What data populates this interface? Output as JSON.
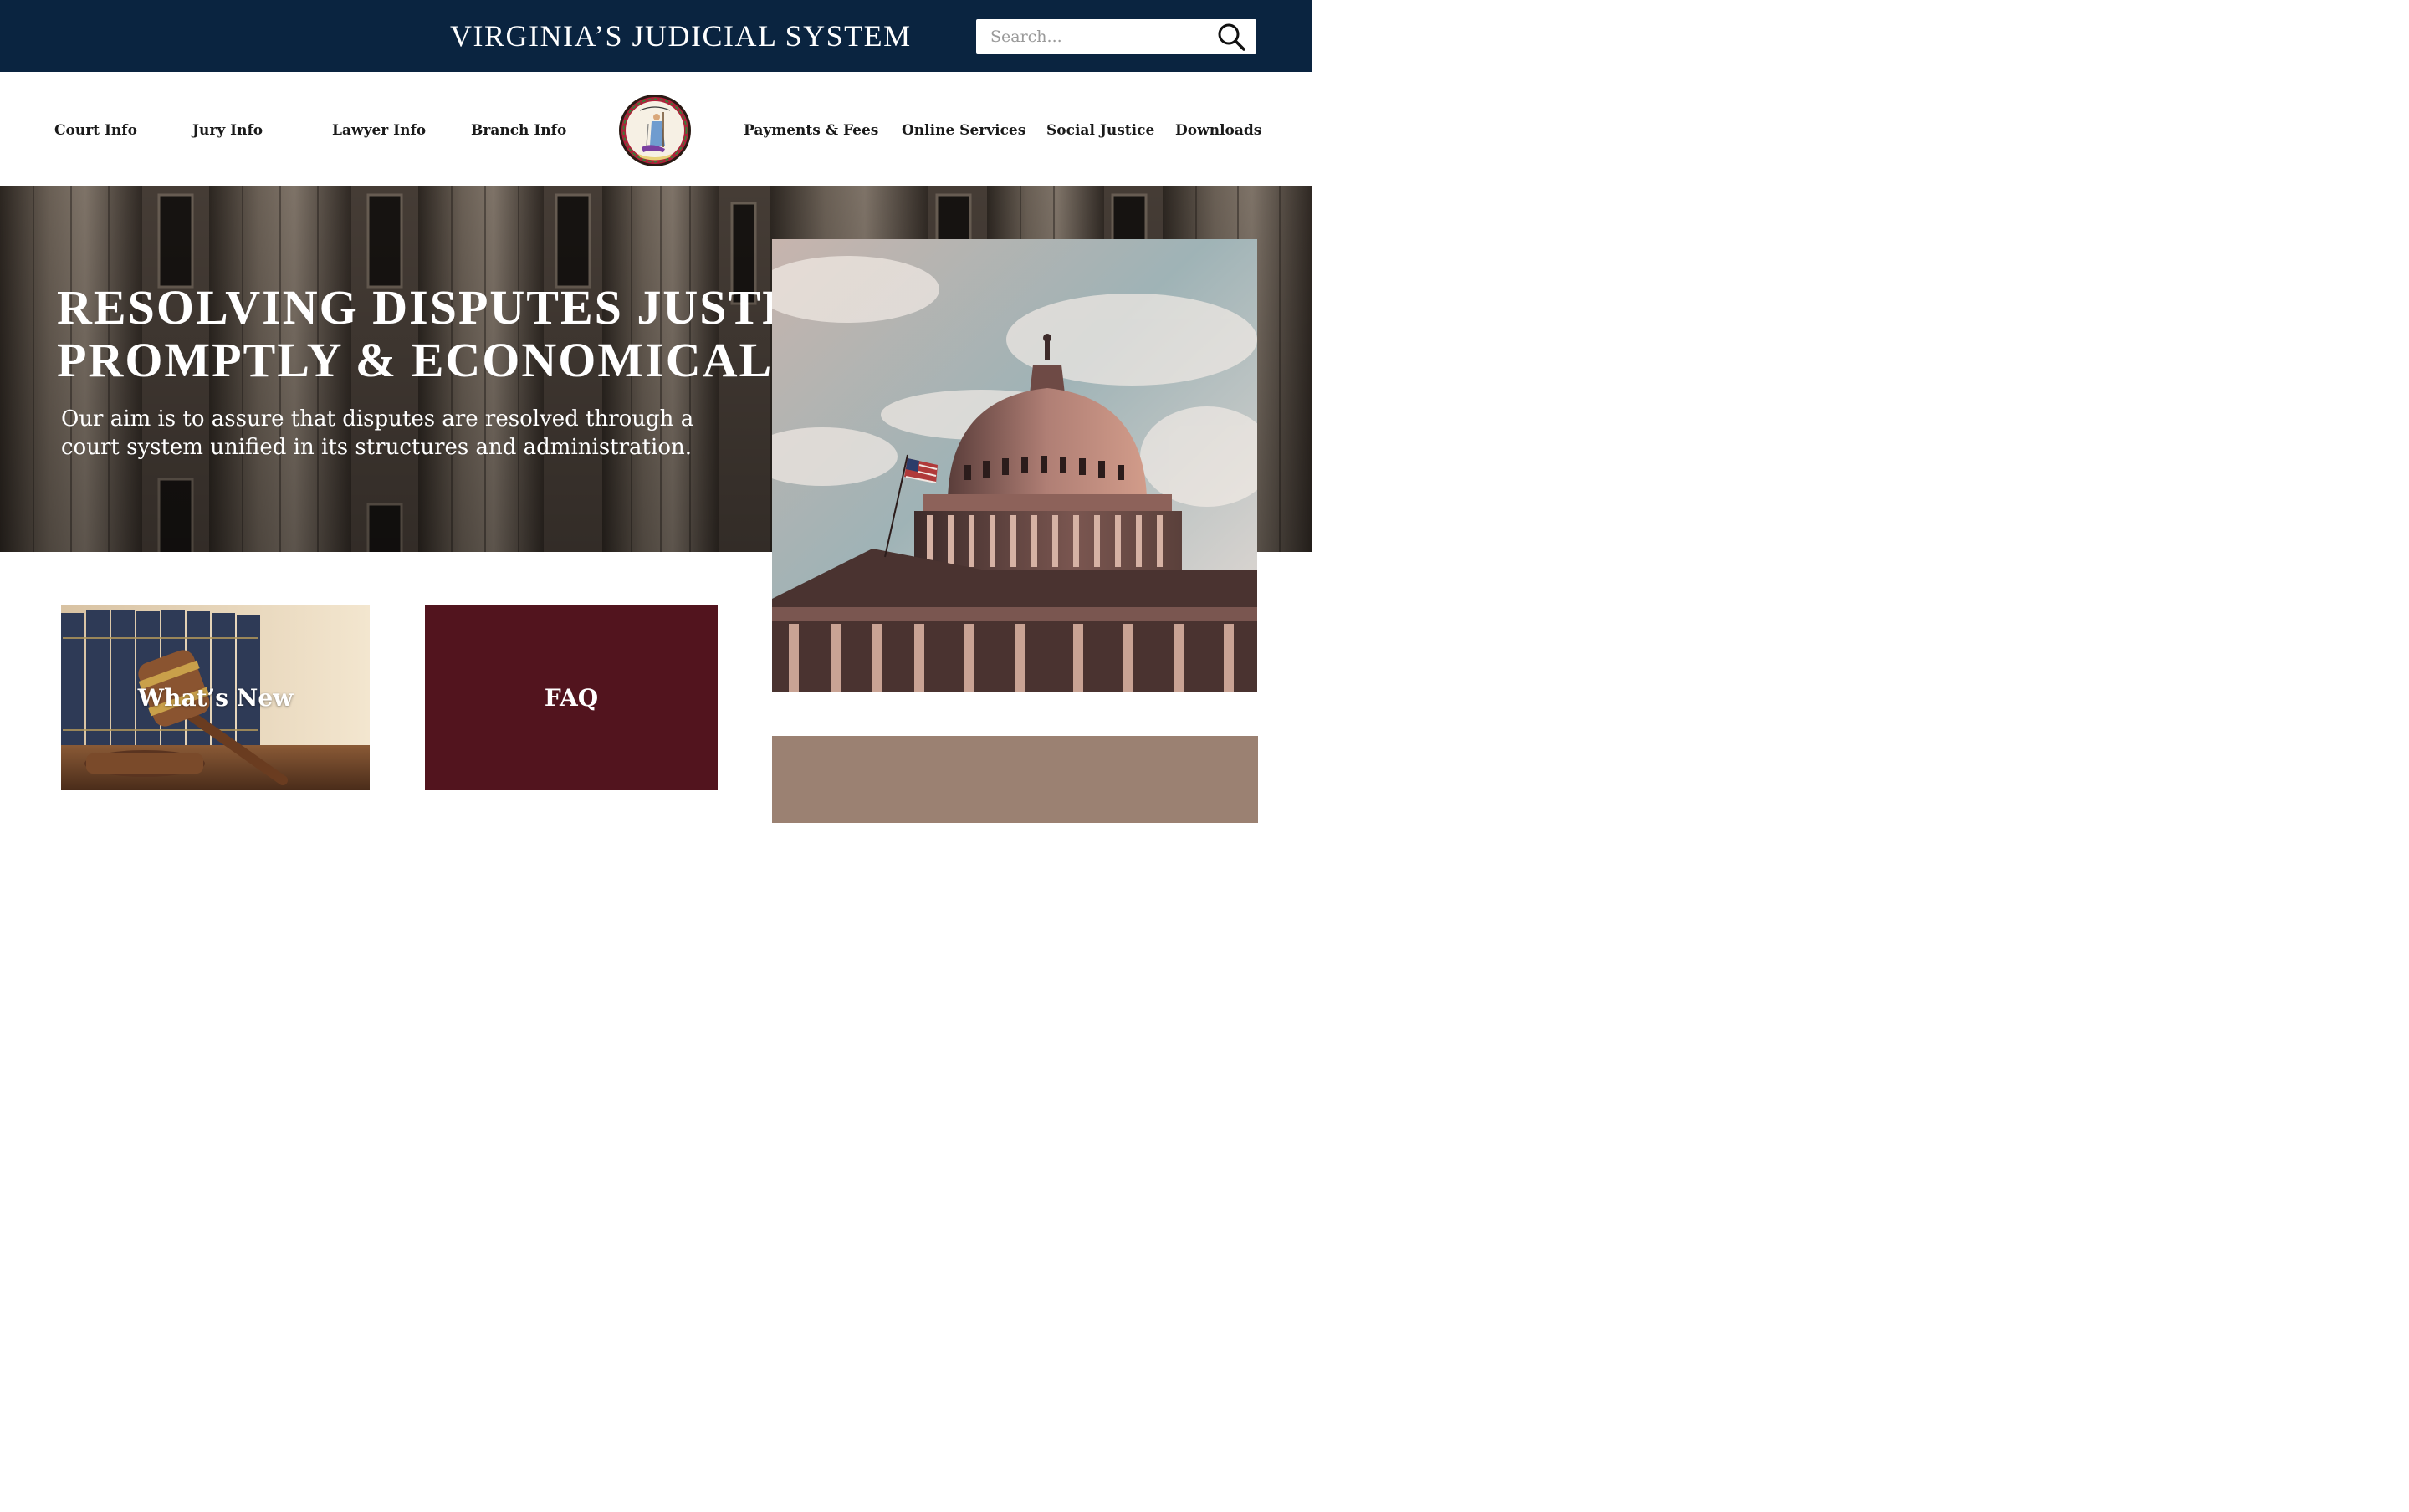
{
  "header": {
    "title": "VIRGINIA’S JUDICIAL SYSTEM",
    "search": {
      "placeholder": "Search...",
      "value": ""
    },
    "background_color": "#0a2440"
  },
  "nav": {
    "left_items": [
      {
        "label": "Court Info"
      },
      {
        "label": "Jury Info"
      },
      {
        "label": "Lawyer Info"
      },
      {
        "label": "Branch Info"
      }
    ],
    "right_items": [
      {
        "label": "Payments & Fees"
      },
      {
        "label": "Online Services"
      },
      {
        "label": "Social Justice"
      },
      {
        "label": "Downloads"
      }
    ],
    "seal": {
      "icon": "virginia-state-seal-icon"
    }
  },
  "hero": {
    "heading_line1": "RESOLVING DISPUTES JUSTLY,",
    "heading_line2": "PROMPTLY & ECONOMICALLY.",
    "subtext": "Our aim is to assure that disputes are resolved through a court system unified in its structures and administration."
  },
  "cards": {
    "whats_new": {
      "label": "What’s New",
      "icon": "gavel-image"
    },
    "faq": {
      "label": "FAQ",
      "color": "#52141e"
    }
  },
  "colors": {
    "accent_tan": "#9b8172",
    "maroon": "#52141e",
    "navy": "#0a2440"
  }
}
